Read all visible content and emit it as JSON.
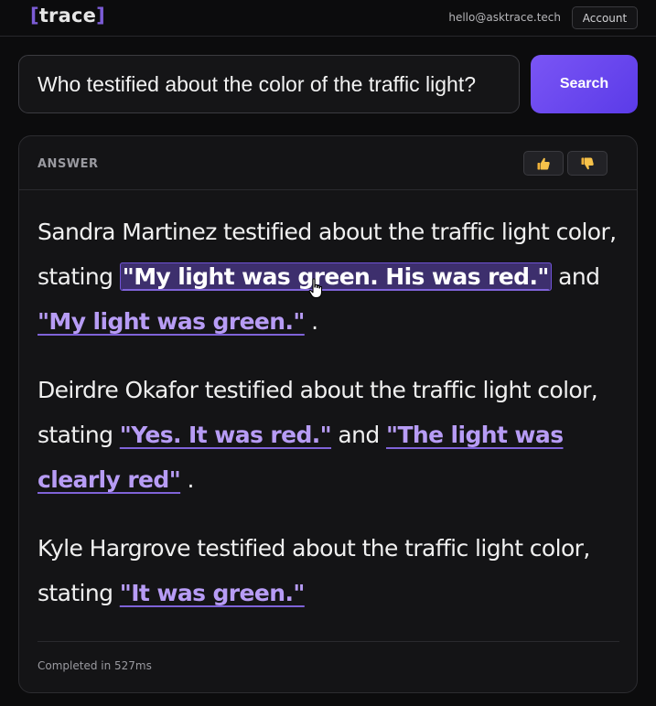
{
  "header": {
    "logo_open": "[",
    "logo_text": "trace",
    "logo_close": "]",
    "email": "hello@asktrace.tech",
    "account_label": "Account"
  },
  "search": {
    "query": "Who testified about the color of the traffic light?",
    "button_label": "Search"
  },
  "answer": {
    "label": "ANSWER",
    "thumbs_up_icon": "thumbs-up-icon",
    "thumbs_down_icon": "thumbs-down-icon",
    "paragraphs": [
      {
        "intro": "Sandra Martinez testified about the traffic light color, stating",
        "quote1": "\"My light was green. His was red.\"",
        "joiner": "and",
        "quote2": "\"My light was green.\"",
        "end": "."
      },
      {
        "intro": "Deirdre Okafor testified about the traffic light color, stating",
        "quote1": "\"Yes. It was red.\"",
        "joiner": "and",
        "quote2": "\"The light was clearly red\"",
        "end": "."
      },
      {
        "intro": "Kyle Hargrove testified about the traffic light color, stating",
        "quote1": "\"It was green.\""
      }
    ],
    "status": "Completed in 527ms"
  },
  "colors": {
    "accent": "#6c47f0",
    "quote": "#b79cf5",
    "background": "#0c0c0d",
    "card": "#141416"
  }
}
